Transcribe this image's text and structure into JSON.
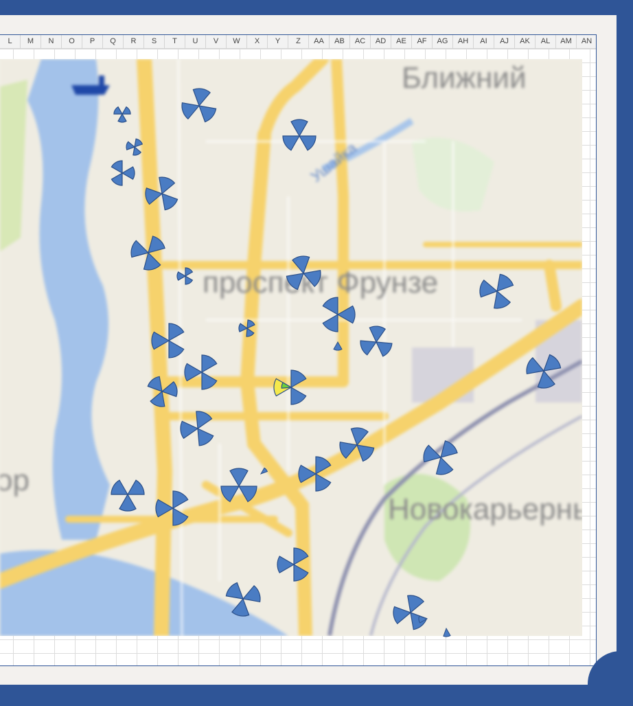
{
  "window": {
    "theme_color": "#2f5597"
  },
  "spreadsheet": {
    "columns": [
      "L",
      "M",
      "N",
      "O",
      "P",
      "Q",
      "R",
      "S",
      "T",
      "U",
      "V",
      "W",
      "X",
      "Y",
      "Z",
      "AA",
      "AB",
      "AC",
      "AD",
      "AE",
      "AF",
      "AG",
      "AH",
      "AI",
      "AJ",
      "AK",
      "AL",
      "AM",
      "AN"
    ]
  },
  "map": {
    "labels": {
      "district_top": "Ближний",
      "avenue": "проспект Фрунзе",
      "river": "Ушайка",
      "district_bottom": "Новокарьерный",
      "edge_text": "ор"
    },
    "colors": {
      "road": "#f8d978",
      "water": "#9fc0e8",
      "park": "#cfe6b4",
      "marker_fill": "#4a7cc3",
      "marker_highlight_1": "#f5e94b",
      "marker_highlight_2": "#6fd13a"
    },
    "markers_icon": "tri-sector-pie-icon",
    "marker_count": 34
  }
}
